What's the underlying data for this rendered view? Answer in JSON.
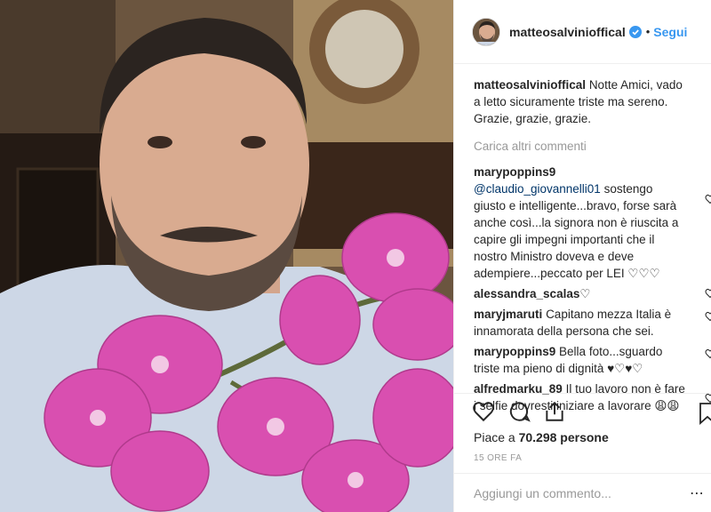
{
  "post": {
    "username": "matteosalvinioffical",
    "follow_label": "Segui",
    "dot": "•",
    "caption_user": "matteosalvinioffical",
    "caption_text": "Notte Amici, vado a letto sicuramente triste ma sereno. Grazie, grazie, grazie.",
    "load_more": "Carica altri commenti",
    "likes_prefix": "Piace a ",
    "likes_count": "70.298",
    "likes_suffix": " persone",
    "time": "15 ORE FA",
    "add_comment_placeholder": "Aggiungi un commento..."
  },
  "comments": [
    {
      "user": "marypoppins9",
      "mention": "@claudio_giovannelli01",
      "text": " sostengo giusto e intelligente...bravo, forse sarà anche così...la signora non è riuscita a capire gli impegni importanti che il nostro Ministro doveva e deve adempiere...peccato per LEI ♡♡♡"
    },
    {
      "user": "alessandra_scalas",
      "text": "♡"
    },
    {
      "user": "maryjmaruti",
      "text": "Capitano mezza Italia è innamorata della persona che sei."
    },
    {
      "user": "marypoppins9",
      "text": "Bella foto...sguardo triste ma pieno di dignità ♥♡♥♡"
    },
    {
      "user": "alfredmarku_89",
      "text": "Il tuo lavoro non è fare i selfie dovresti iniziare a lavorare 😩😩"
    }
  ],
  "colors": {
    "link": "#3897f0",
    "text": "#262626",
    "muted": "#999999",
    "border": "#efefef",
    "orchid": "#d94fb0"
  },
  "icons": [
    "verified-icon",
    "heart-icon",
    "comment-icon",
    "share-icon",
    "bookmark-icon",
    "small-heart-icon",
    "more-options-icon"
  ]
}
